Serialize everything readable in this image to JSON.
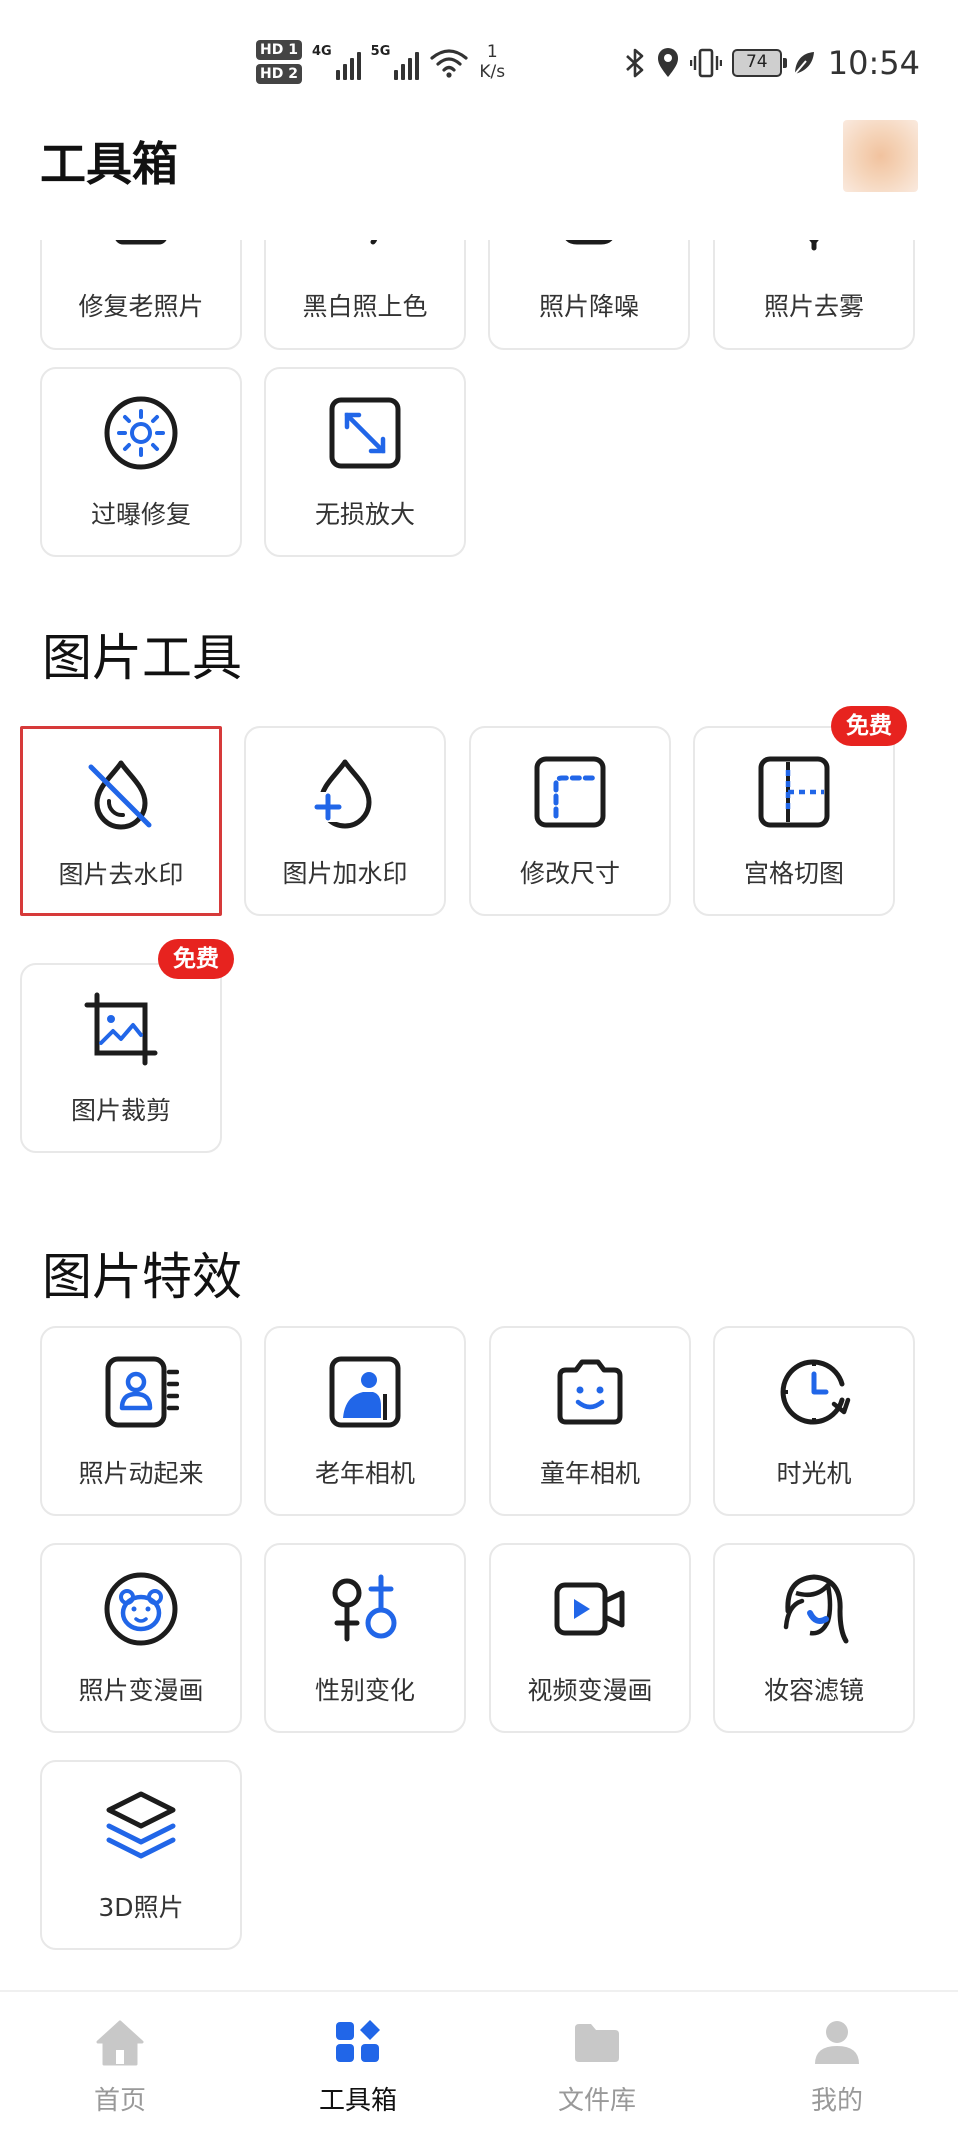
{
  "status_bar": {
    "hd1": "HD 1",
    "hd2": "HD 2",
    "net1": "4G",
    "net2": "5G",
    "speed_value": "1",
    "speed_unit": "K/s",
    "battery": "74",
    "time": "10:54"
  },
  "header": {
    "title": "工具箱"
  },
  "repair_tools": {
    "row1": [
      "修复老照片",
      "黑白照上色",
      "照片降噪",
      "照片去雾"
    ],
    "row2": [
      {
        "label": "过曝修复",
        "icon": "sun-icon"
      },
      {
        "label": "无损放大",
        "icon": "expand-icon"
      }
    ]
  },
  "image_tools": {
    "title": "图片工具",
    "items": [
      {
        "label": "图片去水印",
        "icon": "drop-slash-icon",
        "badge": ""
      },
      {
        "label": "图片加水印",
        "icon": "drop-plus-icon",
        "badge": ""
      },
      {
        "label": "修改尺寸",
        "icon": "resize-icon",
        "badge": ""
      },
      {
        "label": "宫格切图",
        "icon": "grid-split-icon",
        "badge": "免费"
      },
      {
        "label": "图片裁剪",
        "icon": "crop-icon",
        "badge": "免费"
      }
    ]
  },
  "image_effects": {
    "title": "图片特效",
    "items": [
      {
        "label": "照片动起来",
        "icon": "portrait-motion-icon"
      },
      {
        "label": "老年相机",
        "icon": "old-person-icon"
      },
      {
        "label": "童年相机",
        "icon": "smile-camera-icon"
      },
      {
        "label": "时光机",
        "icon": "clock-icon"
      },
      {
        "label": "照片变漫画",
        "icon": "bear-icon"
      },
      {
        "label": "性别变化",
        "icon": "gender-icon"
      },
      {
        "label": "视频变漫画",
        "icon": "video-icon"
      },
      {
        "label": "妆容滤镜",
        "icon": "makeup-face-icon"
      },
      {
        "label": "3D照片",
        "icon": "layers-icon"
      }
    ]
  },
  "bottom_nav": {
    "items": [
      {
        "label": "首页",
        "icon": "home-icon"
      },
      {
        "label": "工具箱",
        "icon": "toolbox-icon"
      },
      {
        "label": "文件库",
        "icon": "folder-icon"
      },
      {
        "label": "我的",
        "icon": "user-icon"
      }
    ],
    "active": "工具箱"
  },
  "colors": {
    "accent": "#2166e8",
    "icon_dark": "#1c1c1c",
    "badge": "#e7231f",
    "selected_border": "#d63a3a",
    "nav_inactive": "#c8c8c8"
  }
}
